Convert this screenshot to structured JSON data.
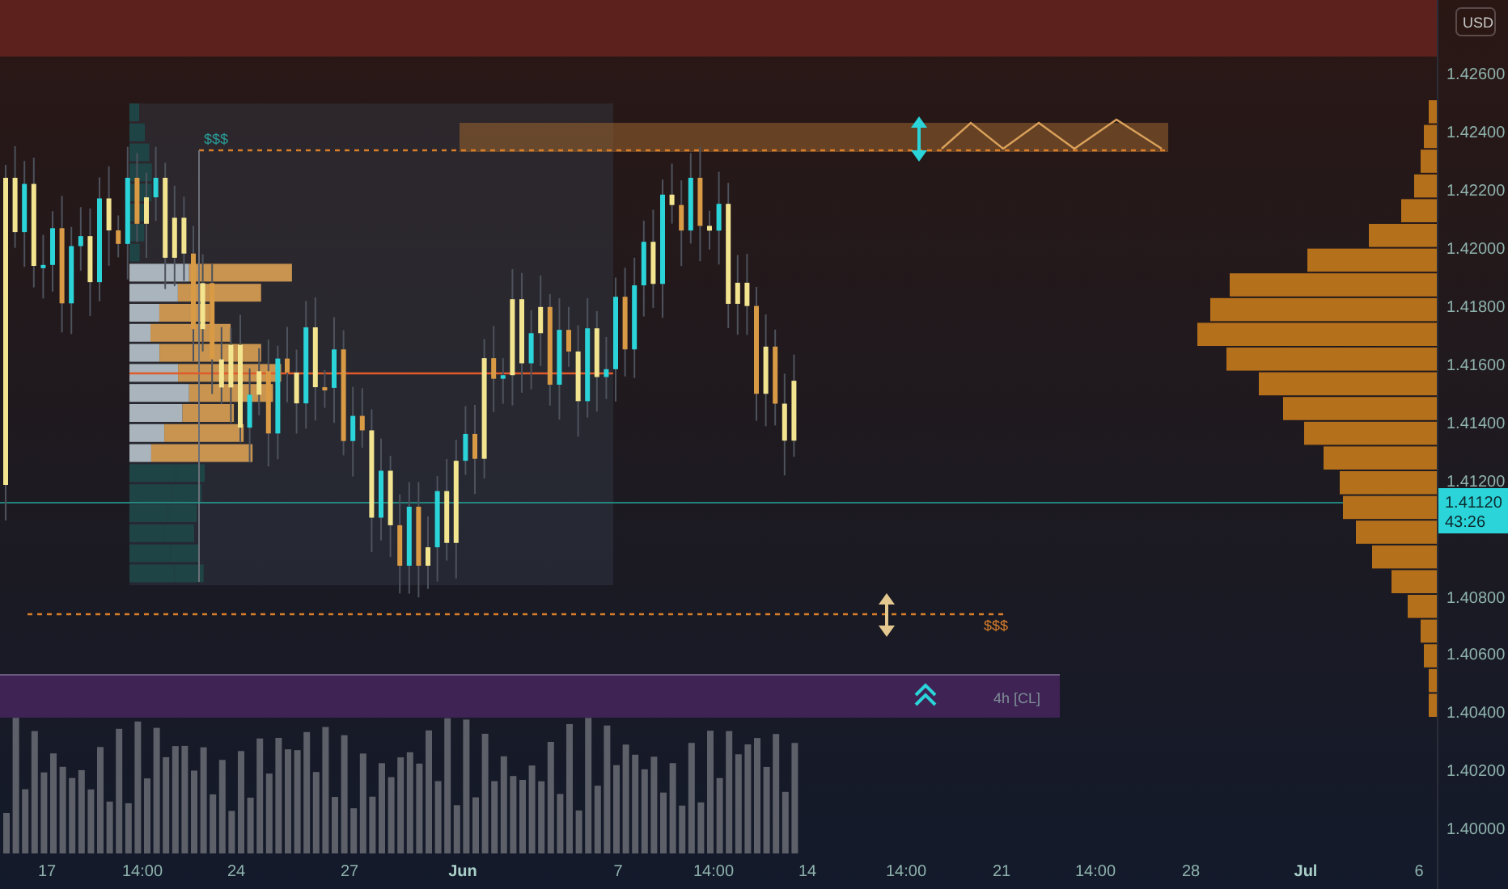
{
  "price_axis": {
    "currency_button": "USD",
    "labels": [
      "1.42600",
      "1.42400",
      "1.42200",
      "1.42000",
      "1.41800",
      "1.41600",
      "1.41400",
      "1.41200",
      "1.40800",
      "1.40600",
      "1.40400",
      "1.40200",
      "1.40000"
    ],
    "current_price": {
      "price": "1.41120",
      "countdown": "43:26"
    }
  },
  "time_axis": {
    "labels": [
      {
        "text": "17",
        "emphasized": false
      },
      {
        "text": "14:00",
        "emphasized": false
      },
      {
        "text": "24",
        "emphasized": false
      },
      {
        "text": "27",
        "emphasized": false
      },
      {
        "text": "Jun",
        "emphasized": true
      },
      {
        "text": "7",
        "emphasized": false
      },
      {
        "text": "14:00",
        "emphasized": false
      },
      {
        "text": "14",
        "emphasized": false
      },
      {
        "text": "14:00",
        "emphasized": false
      },
      {
        "text": "21",
        "emphasized": false
      },
      {
        "text": "14:00",
        "emphasized": false
      },
      {
        "text": "28",
        "emphasized": false
      },
      {
        "text": "Jul",
        "emphasized": true
      },
      {
        "text": "6",
        "emphasized": false
      }
    ]
  },
  "annotations": {
    "liquidity_high_label": "$$$",
    "liquidity_low_label": "$$$",
    "zone_label": "4h [CL]"
  }
}
